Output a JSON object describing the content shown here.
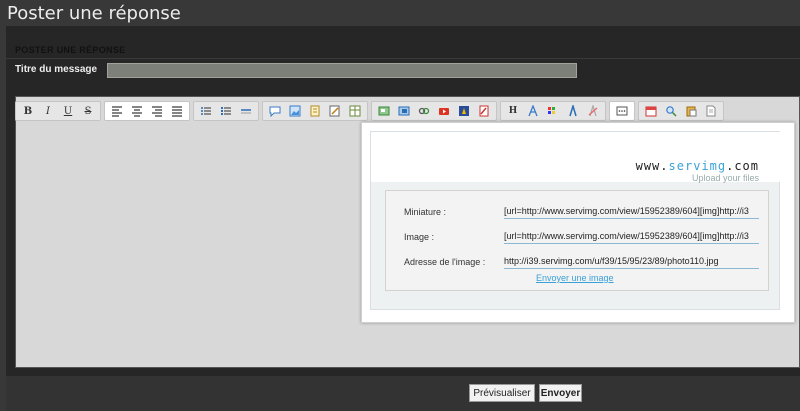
{
  "page": {
    "title": "Poster une réponse"
  },
  "form": {
    "section_title": "POSTER UNE RÉPONSE",
    "title_label": "Titre du message",
    "title_value": ""
  },
  "toolbar": {
    "groups": [
      [
        "bold-icon",
        "italic-icon",
        "underline-icon",
        "strikethrough-icon"
      ],
      [
        "align-left-icon",
        "align-center-icon",
        "align-right-icon",
        "justify-icon"
      ],
      [
        "bullet-list-icon",
        "numbered-list-icon",
        "horizontal-rule-icon"
      ],
      [
        "smiley-icon",
        "image-icon",
        "code-icon",
        "quote-icon",
        "table-icon"
      ],
      [
        "upload-image-icon",
        "flash-icon",
        "link-icon",
        "youtube-icon",
        "spoiler-icon",
        "pdf-icon"
      ],
      [
        "header-icon",
        "font-icon",
        "color-icon",
        "font-size-icon",
        "clear-format-icon"
      ],
      [
        "more-icon"
      ],
      [
        "date-icon",
        "search-icon",
        "paste-icon",
        "document-icon"
      ]
    ],
    "bold": "B",
    "italic": "I",
    "underline": "U",
    "strike": "S",
    "header": "H"
  },
  "servimg": {
    "logo_prefix": "www.",
    "logo_brand": "servimg",
    "logo_suffix": ".com",
    "tagline": "Upload your files",
    "miniature_label": "Miniature :",
    "miniature_value": "[url=http://www.servimg.com/view/15952389/604][img]http://i3",
    "image_label": "Image :",
    "image_value": "[url=http://www.servimg.com/view/15952389/604][img]http://i3",
    "address_label": "Adresse de l'image :",
    "address_value": "http://i39.servimg.com/u/f39/15/95/23/89/photo110.jpg",
    "send_link": "Envoyer une image"
  },
  "buttons": {
    "preview": "Prévisualiser",
    "send": "Envoyer"
  }
}
